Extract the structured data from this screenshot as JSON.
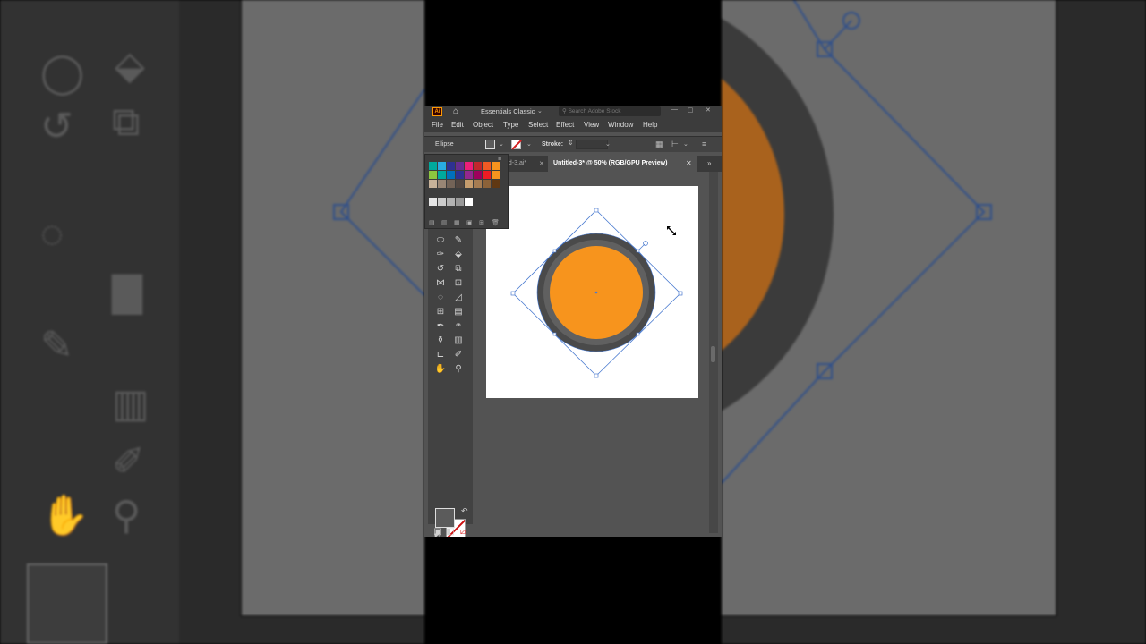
{
  "window": {
    "workspace": "Essentials Classic",
    "search_placeholder": "Search Adobe Stock"
  },
  "menu": [
    "File",
    "Edit",
    "Object",
    "Type",
    "Select",
    "Effect",
    "View",
    "Window",
    "Help"
  ],
  "control_bar": {
    "object_type": "Ellipse",
    "stroke_label": "Stroke:"
  },
  "tabs": {
    "previous": "ed-3.ai*",
    "active": "Untitled-3* @ 50% (RGB/GPU Preview)"
  },
  "artwork": {
    "circle_fill": "#f7941d",
    "ring_color": "#4a4a4a",
    "selection_color": "#4a7bd0"
  },
  "colors": {
    "swatches": [
      "#00a99d",
      "#29abe2",
      "#2e3192",
      "#662d91",
      "#ed1e79",
      "#c1272d",
      "#f15a24",
      "#f7931e",
      "#8cc63f",
      "#00a99d",
      "#0071bc",
      "#2e3192",
      "#93278f",
      "#9e005d",
      "#ed1c24",
      "#f7931e",
      "#c7b299",
      "#998675",
      "#736357",
      "#534741",
      "#c69c6d",
      "#a67c52",
      "#8c6239",
      "#603813",
      "#e6e6e6",
      "#cccccc",
      "#b3b3b3",
      "#999999",
      "#ffffff"
    ]
  }
}
